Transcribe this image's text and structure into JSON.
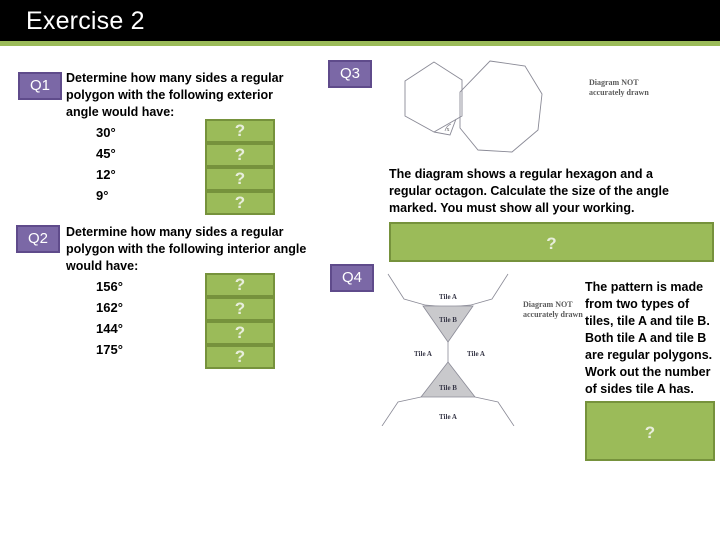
{
  "header": {
    "title": "Exercise 2",
    "bar_color": "#000000",
    "accent_color": "#9bbb59"
  },
  "theme": {
    "badge_fill": "#7b68a6",
    "badge_border": "#5f4b8b",
    "answer_fill": "#9bbb59",
    "answer_border": "#76923c",
    "answer_text": "?"
  },
  "questions": [
    {
      "badge": "Q1",
      "prompt": "Determine how many sides a regular polygon with the following exterior angle would have:",
      "items": [
        "30°",
        "45°",
        "12°",
        "9°"
      ],
      "answers": [
        "?",
        "?",
        "?",
        "?"
      ]
    },
    {
      "badge": "Q2",
      "prompt": "Determine how many sides a regular polygon with the following interior angle would have:",
      "items": [
        "156°",
        "162°",
        "144°",
        "175°"
      ],
      "answers": [
        "?",
        "?",
        "?",
        "?"
      ]
    },
    {
      "badge": "Q3",
      "prompt": "The diagram shows a regular hexagon and a regular octagon. Calculate the size of the angle marked. You must show all your working.",
      "answer": "?",
      "note": "Diagram NOT accurately drawn",
      "note_line1": "Diagram NOT",
      "note_line2": "accurately drawn",
      "angle_label": "x"
    },
    {
      "badge": "Q4",
      "prompt": "The pattern is made from two types of tiles, tile A and tile B. Both tile A and tile B are regular polygons. Work out the number of sides tile A has.",
      "answer": "?",
      "note_line1": "Diagram NOT",
      "note_line2": "accurately drawn",
      "tile_labels": {
        "top_a": "Tile A",
        "top_b": "Tile B",
        "mid_left_a": "Tile A",
        "mid_right_a": "Tile A",
        "bottom_b": "Tile B",
        "bottom_a": "Tile A"
      }
    }
  ]
}
